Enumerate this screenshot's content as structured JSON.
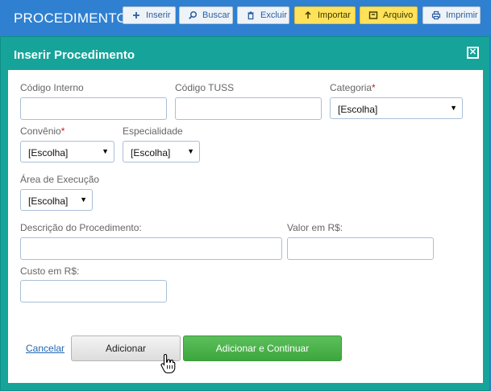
{
  "app_title": "PROCEDIMENTOS",
  "toolbar": {
    "buttons": [
      {
        "label": "Inserir",
        "icon": "plus-icon"
      },
      {
        "label": "Buscar",
        "icon": "search-icon"
      },
      {
        "label": "Excluir",
        "icon": "trash-icon"
      },
      {
        "label": "Importar",
        "icon": "upload-arrow-icon"
      },
      {
        "label": "Arquivo",
        "icon": "archive-icon"
      },
      {
        "label": "Imprimir",
        "icon": "printer-icon"
      }
    ]
  },
  "modal": {
    "title": "Inserir Procedimento",
    "close_icon": "close-icon"
  },
  "form": {
    "codigo_interno": {
      "label": "Código Interno",
      "value": ""
    },
    "codigo_tuss": {
      "label": "Código TUSS",
      "value": ""
    },
    "categoria": {
      "label": "Categoria",
      "required_mark": "*",
      "value": "[Escolha]"
    },
    "convenio": {
      "label": "Convênio",
      "required_mark": "*",
      "value": "[Escolha]"
    },
    "especialidade": {
      "label": "Especialidade",
      "value": "[Escolha]"
    },
    "area_execucao": {
      "label": "Área de Execução",
      "value": "[Escolha]"
    },
    "descricao": {
      "label": "Descrição do Procedimento:",
      "value": ""
    },
    "valor": {
      "label": "Valor em R$:",
      "value": ""
    },
    "custo": {
      "label": "Custo em R$:",
      "value": ""
    },
    "dropdown_arrow": "▼"
  },
  "actions": {
    "cancel": "Cancelar",
    "add": "Adicionar",
    "add_continue": "Adicionar e Continuar"
  },
  "colors": {
    "topbar": "#2f80d1",
    "modal_header": "#16a39a",
    "primary_green": "#4cae4c",
    "required": "#d11a1a"
  }
}
